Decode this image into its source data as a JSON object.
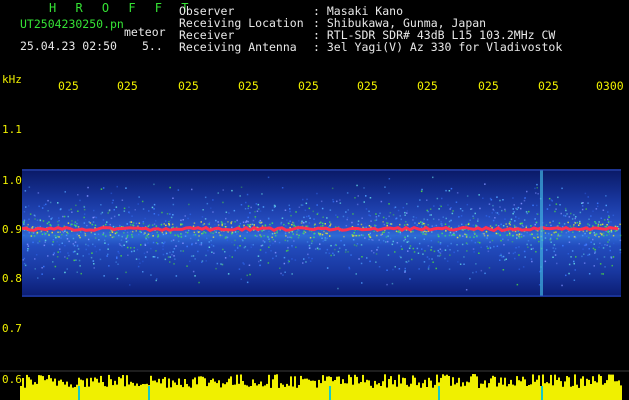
{
  "header": {
    "title": "H R O F F T",
    "filename": "UT2504230250.pn",
    "subtitle": "meteor",
    "date": "25.04.23 02:50",
    "value": "5.."
  },
  "info": [
    {
      "label": "Observer",
      "value": ": Masaki Kano"
    },
    {
      "label": "Receiving Location",
      "value": ": Shibukawa, Gunma, Japan"
    },
    {
      "label": "Receiver",
      "value": ": RTL-SDR SDR# 43dB L15 103.2MHz CW"
    },
    {
      "label": "Receiving Antenna",
      "value": ": 3el Yagi(V) Az 330 for Vladivostok"
    }
  ],
  "axis": {
    "unit": "kHz",
    "y_ticks": [
      "1.1",
      "1.0",
      "0.9",
      "0.8",
      "0.7",
      "0.6"
    ],
    "x_ticks": [
      "025",
      "025",
      "025",
      "025",
      "025",
      "025",
      "025",
      "025",
      "025",
      "0300"
    ]
  },
  "colors": {
    "background": "#000000",
    "header_green": "#35e335",
    "tick_yellow": "#f0f000",
    "signal_red": "#ff2040",
    "noise_blue": "#1d3fb0"
  }
}
